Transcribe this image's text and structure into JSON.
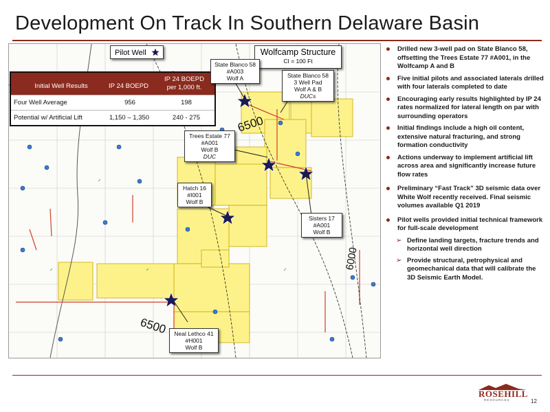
{
  "title": "Development On Track In Southern Delaware Basin",
  "legend": {
    "pilot_label": "Pilot Well"
  },
  "structure": {
    "title": "Wolfcamp Structure",
    "ci": "CI = 100 Ft"
  },
  "results_table": {
    "headers": [
      "Initial Well Results",
      "IP 24 BOEPD",
      "IP 24 BOEPD",
      "per 1,000 ft."
    ],
    "rows": [
      [
        "Four Well Average",
        "956",
        "198"
      ],
      [
        "Potential w/ Artificial Lift",
        "1,150 – 1,350",
        "240 - 275"
      ]
    ]
  },
  "contours": {
    "c1": "6500",
    "c2": "6500",
    "c3": "6000"
  },
  "callouts": {
    "blanco58": [
      "State Blanco 58",
      "#A003",
      "Wolf A"
    ],
    "blanco58pad": [
      "State Blanco 58",
      "3 Well Pad",
      "Wolf A & B",
      "DUCs"
    ],
    "trees": [
      "Trees Estate 77",
      "#A001",
      "Wolf B",
      "DUC"
    ],
    "hatch": [
      "Hatch 16",
      "#I001",
      "Wolf B"
    ],
    "sisters": [
      "Sisters 17",
      "#A001",
      "Wolf B"
    ],
    "neal": [
      "Neal Lethco 41",
      "#H001",
      "Wolf B"
    ]
  },
  "bullets": [
    "Drilled new 3-well pad on State Blanco 58, offsetting the Trees Estate 77 #A001, in the Wolfcamp A and B",
    "Five initial pilots and associated laterals drilled with four laterals completed to date",
    "Encouraging early results highlighted by IP 24 rates normalized for lateral length on par with surrounding operators",
    "Initial findings include a high oil content, extensive natural fracturing, and strong formation conductivity",
    "Actions underway to implement artificial lift across area and significantly increase future flow rates",
    "Preliminary “Fast Track” 3D seismic data over White Wolf recently received. Final seismic volumes available  Q1 2019",
    "Pilot wells provided initial technical framework for full-scale development"
  ],
  "sub_bullets": [
    "Define landing targets, fracture trends and horizontal well direction",
    "Provide structural, petrophysical and geomechanical data that will calibrate the 3D Seismic Earth Model."
  ],
  "logo": {
    "word": "ROSEHILL",
    "sub": "RESOURCES"
  },
  "page_number": "12",
  "colors": {
    "accent": "#8b2a1e",
    "acreage": "#fdf28a",
    "well_marker": "#3a7bd5"
  }
}
